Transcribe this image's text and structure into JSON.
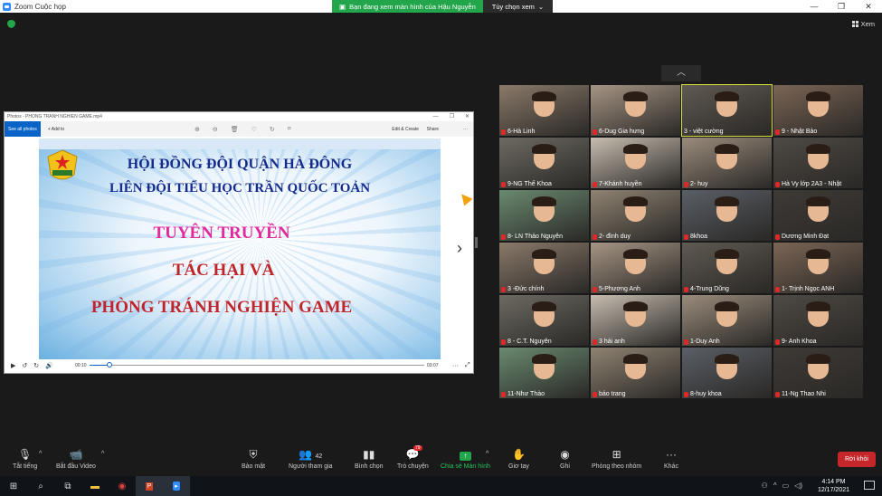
{
  "window": {
    "title": "Zoom Cuộc họp",
    "controls": [
      "—",
      "❐",
      "✕"
    ]
  },
  "share_banner": {
    "viewing": "Bạn đang xem màn hình của Hậu Nguyễn",
    "options": "Tùy chọn xem"
  },
  "view_button": "Xem",
  "photos": {
    "title": "Photos - PHONG TRANH NGHIEN GAME.mp4",
    "see_all": "See all photos",
    "add_to": "+ Add to",
    "edit_create": "Edit & Create",
    "share": "Share",
    "time_current": "00:10",
    "time_total": "03:07",
    "progress": 0.06
  },
  "slide": {
    "line1": "HỘI ĐỒNG ĐỘI QUẬN HÀ ĐÔNG",
    "line2": "LIÊN ĐỘI TIỂU HỌC TRẦN QUỐC TOẢN",
    "line3": "TUYÊN TRUYỀN",
    "line4": "TÁC HẠI VÀ",
    "line5": "PHÒNG TRÁNH NGHIỆN GAME",
    "logo_text": "SẴN SÀNG"
  },
  "participants": [
    {
      "name": "6-Hà Linh",
      "muted": true
    },
    {
      "name": "6-Dug Gia hưng",
      "muted": true
    },
    {
      "name": "3 - việt cường",
      "muted": false,
      "active": true
    },
    {
      "name": "9 - Nhật Bảo",
      "muted": true
    },
    {
      "name": "9-NG Thế Khoa",
      "muted": true
    },
    {
      "name": "7-Khánh huyền",
      "muted": true
    },
    {
      "name": "2- huy",
      "muted": true
    },
    {
      "name": "Hà Vy lớp 2A3 - Nhật",
      "muted": true
    },
    {
      "name": "8- LN Thảo Nguyên",
      "muted": true
    },
    {
      "name": "2- đình duy",
      "muted": true
    },
    {
      "name": "8khoa",
      "muted": true
    },
    {
      "name": "Dương Minh Đạt",
      "muted": true
    },
    {
      "name": "3 -Đức chính",
      "muted": true
    },
    {
      "name": "5-Phương Anh",
      "muted": true
    },
    {
      "name": "4-Trung Dũng",
      "muted": true
    },
    {
      "name": "1- Trịnh Ngọc ANH",
      "muted": true
    },
    {
      "name": "8 - C.T. Nguyên",
      "muted": true
    },
    {
      "name": "3 hải anh",
      "muted": true
    },
    {
      "name": "1-Duy Anh",
      "muted": true
    },
    {
      "name": "9- Anh Khoa",
      "muted": true
    },
    {
      "name": "11-Như Thảo",
      "muted": true
    },
    {
      "name": "bảo trang",
      "muted": true
    },
    {
      "name": "8-huy khoa",
      "muted": true
    },
    {
      "name": "11-Ng Thao Nhi",
      "muted": true
    }
  ],
  "toolbar": {
    "mute": "Tắt tiếng",
    "video": "Bắt đầu Video",
    "security": "Bảo mật",
    "participants": "Người tham gia",
    "participants_count": "42",
    "polls": "Bình chọn",
    "chat": "Trò chuyện",
    "chat_badge": "79",
    "share": "Chia sẻ Màn hình",
    "raise_hand": "Giơ tay",
    "record": "Ghi",
    "breakout": "Phòng theo nhóm",
    "more": "Khác",
    "leave": "Rời khỏi"
  },
  "taskbar": {
    "time": "4:14 PM",
    "date": "12/17/2021"
  },
  "colors": {
    "accent_green": "#23a54b",
    "active_border": "#d7e13a",
    "leave_red": "#c4262a"
  }
}
